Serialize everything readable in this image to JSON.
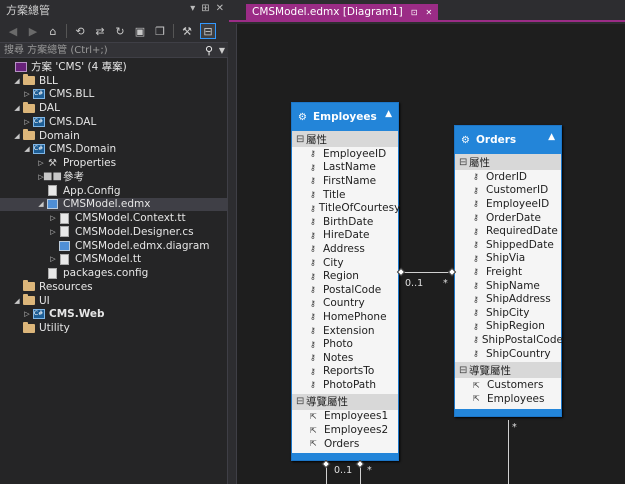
{
  "solution_explorer": {
    "title": "方案總管",
    "title_controls": [
      "▾",
      "⊞",
      "✕"
    ],
    "search_placeholder": "搜尋 方案總管 (Ctrl+;)",
    "tree": [
      {
        "label": "方案 'CMS' (4 專案)",
        "level": 0,
        "icon": "solution-icon",
        "arrow": ""
      },
      {
        "label": "BLL",
        "level": 1,
        "icon": "folder-icon",
        "arrow": "◢"
      },
      {
        "label": "CMS.BLL",
        "level": 2,
        "icon": "csharp-project-icon",
        "arrow": "▷"
      },
      {
        "label": "DAL",
        "level": 1,
        "icon": "folder-icon",
        "arrow": "◢"
      },
      {
        "label": "CMS.DAL",
        "level": 2,
        "icon": "csharp-project-icon",
        "arrow": "▷"
      },
      {
        "label": "Domain",
        "level": 1,
        "icon": "folder-icon",
        "arrow": "◢"
      },
      {
        "label": "CMS.Domain",
        "level": 2,
        "icon": "csharp-project-icon",
        "arrow": "◢"
      },
      {
        "label": "Properties",
        "level": 3,
        "icon": "wrench-icon",
        "arrow": "▷"
      },
      {
        "label": "參考",
        "level": 3,
        "icon": "references-icon",
        "arrow": "▷"
      },
      {
        "label": "App.Config",
        "level": 3,
        "icon": "config-file-icon",
        "arrow": ""
      },
      {
        "label": "CMSModel.edmx",
        "level": 3,
        "icon": "edmx-icon",
        "arrow": "◢",
        "selected": true
      },
      {
        "label": "CMSModel.Context.tt",
        "level": 4,
        "icon": "tt-file-icon",
        "arrow": "▷"
      },
      {
        "label": "CMSModel.Designer.cs",
        "level": 4,
        "icon": "cs-file-icon",
        "arrow": "▷"
      },
      {
        "label": "CMSModel.edmx.diagram",
        "level": 4,
        "icon": "diagram-file-icon",
        "arrow": ""
      },
      {
        "label": "CMSModel.tt",
        "level": 4,
        "icon": "tt-file-icon",
        "arrow": "▷"
      },
      {
        "label": "packages.config",
        "level": 3,
        "icon": "config-file-icon",
        "arrow": ""
      },
      {
        "label": "Resources",
        "level": 1,
        "icon": "folder-icon",
        "arrow": ""
      },
      {
        "label": "UI",
        "level": 1,
        "icon": "folder-icon",
        "arrow": "◢"
      },
      {
        "label": "CMS.Web",
        "level": 2,
        "icon": "web-project-icon",
        "arrow": "▷",
        "bold": true
      },
      {
        "label": "Utility",
        "level": 1,
        "icon": "folder-icon",
        "arrow": ""
      }
    ]
  },
  "document": {
    "tab_label": "CMSModel.edmx [Diagram1]",
    "tab_controls": [
      "⊡",
      "✕"
    ]
  },
  "entities": {
    "employees": {
      "name": "Employees",
      "properties_header": "屬性",
      "properties": [
        "EmployeeID",
        "LastName",
        "FirstName",
        "Title",
        "TitleOfCourtesy",
        "BirthDate",
        "HireDate",
        "Address",
        "City",
        "Region",
        "PostalCode",
        "Country",
        "HomePhone",
        "Extension",
        "Photo",
        "Notes",
        "ReportsTo",
        "PhotoPath"
      ],
      "navigation_header": "導覽屬性",
      "navigation": [
        "Employees1",
        "Employees2",
        "Orders"
      ]
    },
    "orders": {
      "name": "Orders",
      "properties_header": "屬性",
      "properties": [
        "OrderID",
        "CustomerID",
        "EmployeeID",
        "OrderDate",
        "RequiredDate",
        "ShippedDate",
        "ShipVia",
        "Freight",
        "ShipName",
        "ShipAddress",
        "ShipCity",
        "ShipRegion",
        "ShipPostalCode",
        "ShipCountry"
      ],
      "navigation_header": "導覽屬性",
      "navigation": [
        "Customers",
        "Employees"
      ]
    }
  },
  "associations": {
    "emp_orders_left": "0..1",
    "emp_orders_right": "*",
    "orders_bottom": "*",
    "emp_self_left": "0..1",
    "emp_self_right": "*"
  },
  "colors": {
    "entity_header": "#2385d9",
    "tab_accent": "#9b2c86",
    "canvas": "#1e1e1e"
  }
}
